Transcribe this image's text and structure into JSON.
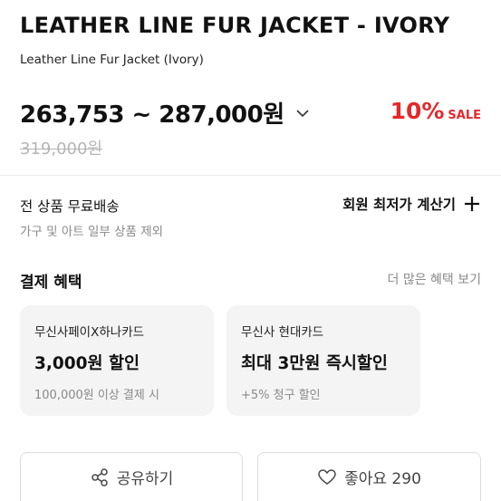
{
  "product": {
    "title": "LEATHER LINE FUR JACKET - IVORY",
    "subtitle": "Leather Line Fur Jacket (Ivory)"
  },
  "price": {
    "range": "263,753 ~ 287,000원",
    "discount_percent": "10%",
    "discount_label": "SALE",
    "original": "319,000원",
    "accent_color": "#e5282b"
  },
  "shipping": {
    "label": "전 상품 무료배송",
    "note": "가구 및 아트 일부 상품 제외",
    "calculator_label": "회원 최저가 계산기"
  },
  "benefits": {
    "title": "결제 혜택",
    "more_label": "더 많은 혜택 보기",
    "cards": [
      {
        "name": "무신사페이X하나카드",
        "headline": "3,000원 할인",
        "condition": "100,000원 이상 결제 시"
      },
      {
        "name": "무신사 현대카드",
        "headline": "최대 3만원 즉시할인",
        "condition": "+5% 청구 할인"
      }
    ]
  },
  "actions": {
    "share_label": "공유하기",
    "share_icon": "share-icon",
    "like_label": "좋아요 290",
    "like_icon": "heart-icon"
  }
}
